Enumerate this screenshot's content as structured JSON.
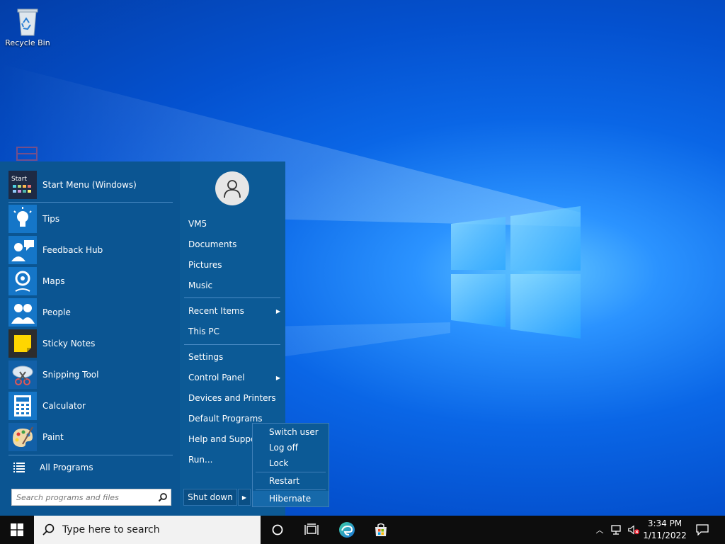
{
  "desktop": {
    "recycle_bin_label": "Recycle Bin"
  },
  "start_menu": {
    "pinned_top": {
      "label": "Start Menu (Windows)"
    },
    "apps": [
      {
        "label": "Tips",
        "icon": "lightbulb-icon"
      },
      {
        "label": "Feedback Hub",
        "icon": "feedback-hub-icon"
      },
      {
        "label": "Maps",
        "icon": "maps-icon"
      },
      {
        "label": "People",
        "icon": "people-icon"
      },
      {
        "label": "Sticky Notes",
        "icon": "sticky-notes-icon"
      },
      {
        "label": "Snipping Tool",
        "icon": "snipping-tool-icon"
      },
      {
        "label": "Calculator",
        "icon": "calculator-icon"
      },
      {
        "label": "Paint",
        "icon": "paint-icon"
      }
    ],
    "start_icon_text": "Start",
    "all_programs_label": "All Programs",
    "search_placeholder": "Search programs and files",
    "places": [
      {
        "label": "VM5"
      },
      {
        "label": "Documents"
      },
      {
        "label": "Pictures"
      },
      {
        "label": "Music"
      },
      {
        "label": "Recent Items",
        "has_submenu": true
      },
      {
        "label": "This PC"
      },
      {
        "label": "Settings"
      },
      {
        "label": "Control Panel",
        "has_submenu": true
      },
      {
        "label": "Devices and Printers"
      },
      {
        "label": "Default Programs"
      },
      {
        "label": "Help and Support"
      },
      {
        "label": "Run..."
      }
    ],
    "shutdown_label": "Shut down"
  },
  "power_menu": {
    "items": [
      {
        "label": "Switch user"
      },
      {
        "label": "Log off"
      },
      {
        "label": "Lock"
      },
      {
        "label": "Restart"
      },
      {
        "label": "Hibernate"
      }
    ]
  },
  "taskbar": {
    "search_placeholder": "Type here to search",
    "clock": {
      "time": "3:34 PM",
      "date": "1/11/2022"
    }
  },
  "colors": {
    "menu_bg": "#0c5a96",
    "taskbar_bg": "#0d0d0d",
    "highlight": "#1669aa"
  }
}
